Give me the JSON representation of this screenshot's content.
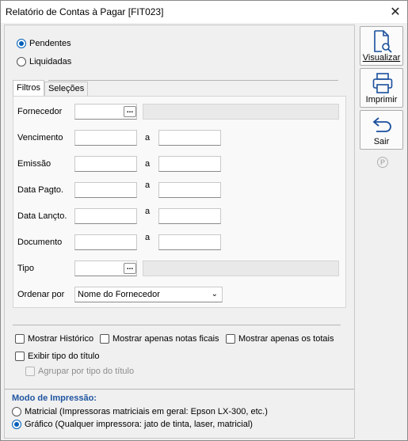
{
  "window": {
    "title": "Relatório de Contas à Pagar [FIT023]",
    "close_glyph": "✕"
  },
  "status": {
    "pendentes": "Pendentes",
    "liquidadas": "Liquidadas",
    "selected": "pendentes"
  },
  "tabs": [
    {
      "label": "Filtros",
      "active": true
    },
    {
      "label": "Seleções",
      "active": false
    }
  ],
  "filters": {
    "fornecedor": {
      "label": "Fornecedor",
      "button": "..."
    },
    "vencimento": {
      "label": "Vencimento",
      "sep": "a"
    },
    "emissao": {
      "label": "Emissão",
      "sep": "a"
    },
    "data_pagto": {
      "label": "Data Pagto.",
      "sep": "a"
    },
    "data_lancto": {
      "label": "Data Lançto.",
      "sep": "a"
    },
    "documento": {
      "label": "Documento",
      "sep": "a"
    },
    "tipo": {
      "label": "Tipo",
      "button": "..."
    },
    "ordenar": {
      "label": "Ordenar por",
      "value": "Nome do Fornecedor"
    }
  },
  "options": {
    "mostrar_historico": "Mostrar Histórico",
    "mostrar_notas": "Mostrar apenas notas ficais",
    "mostrar_totais": "Mostrar apenas os totais",
    "exibir_tipo": "Exibir tipo do título",
    "agrupar_tipo": "Agrupar por tipo do título"
  },
  "print_mode": {
    "title": "Modo de Impressão:",
    "matricial": "Matricial (Impressoras matriciais em geral: Epson LX-300, etc.)",
    "grafico": "Gráfico (Qualquer impressora: jato de tinta, laser, matricial)",
    "selected": "grafico"
  },
  "actions": {
    "visualizar": "Visualizar",
    "imprimir": "Imprimir",
    "sair": "Sair",
    "p_icon": "P"
  },
  "colors": {
    "accent": "#005fb8",
    "section_title": "#1f55a0"
  },
  "icons": {
    "visualizar": "document-search-icon",
    "imprimir": "printer-icon",
    "sair": "undo-arrow-icon",
    "p_icon": "circled-p-icon"
  }
}
